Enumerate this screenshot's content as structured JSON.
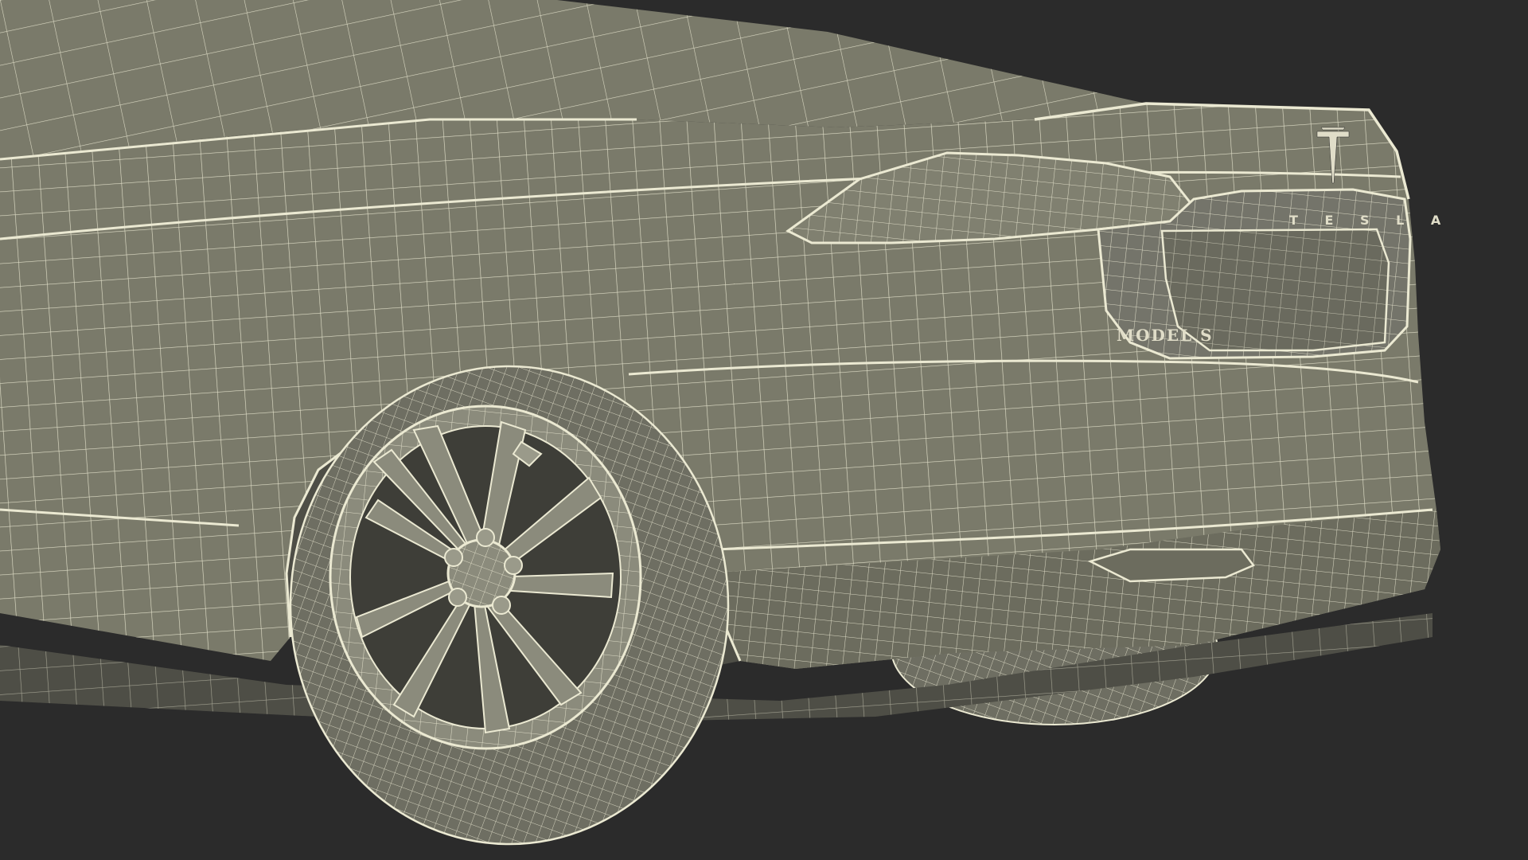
{
  "colors": {
    "background": "#2b2b2b",
    "body_surface": "#7a7a6a",
    "body_surface_dark": "#5f5f52",
    "shadow_surface": "#4e4e46",
    "wire": "#ebe9d2",
    "tire": "#6e6e62",
    "rim": "#8b8b7c",
    "emblem": "#e0ddc8"
  },
  "icons": {
    "logo": "tesla-t-emblem-icon"
  },
  "badges": {
    "model": "MODEL S",
    "brand": "T E S L A"
  }
}
